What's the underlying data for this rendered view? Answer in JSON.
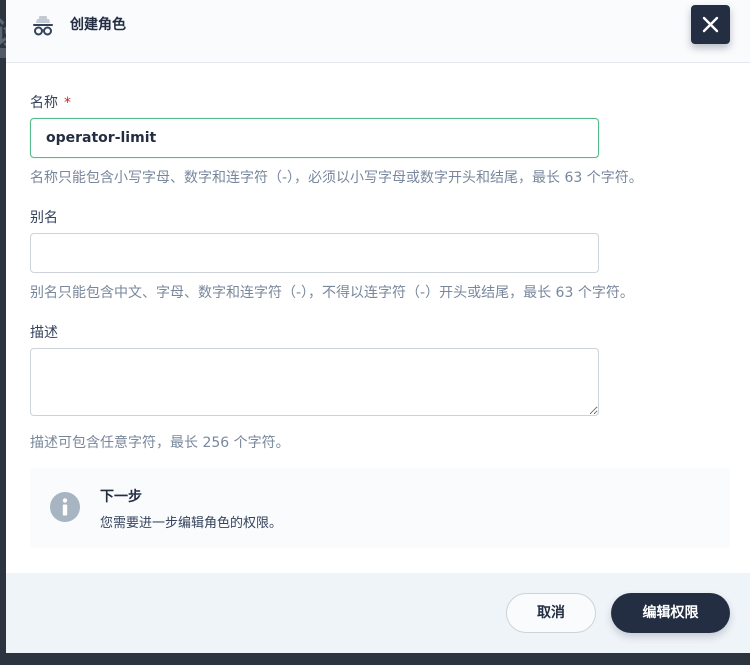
{
  "header": {
    "title": "创建角色",
    "icon": "incognito-icon"
  },
  "form": {
    "name": {
      "label": "名称",
      "required_mark": "*",
      "value": "operator-limit",
      "hint": "名称只能包含小写字母、数字和连字符（-），必须以小写字母或数字开头和结尾，最长 63 个字符。"
    },
    "alias": {
      "label": "别名",
      "value": "",
      "hint": "别名只能包含中文、字母、数字和连字符（-），不得以连字符（-）开头或结尾，最长 63 个字符。"
    },
    "description": {
      "label": "描述",
      "value": "",
      "hint": "描述可包含任意字符，最长 256 个字符。"
    }
  },
  "info": {
    "icon": "info-icon",
    "title": "下一步",
    "text": "您需要进一步编辑角色的权限。"
  },
  "footer": {
    "cancel_label": "取消",
    "next_label": "编辑权限"
  },
  "colors": {
    "primary": "#242e42",
    "focus_border": "#55bc8a",
    "required": "#ca2621",
    "hint_text": "#79879c"
  }
}
